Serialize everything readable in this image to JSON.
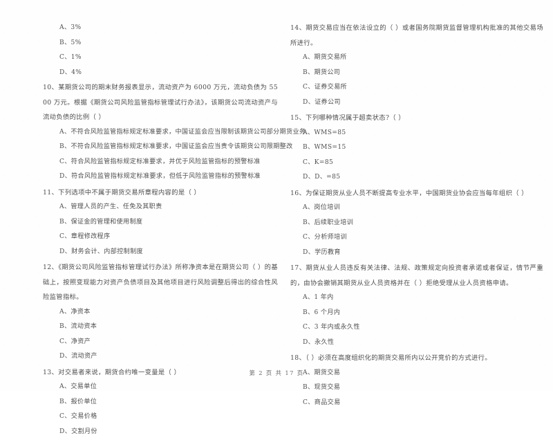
{
  "document": {
    "page_footer": "第 2 页 共 17 页",
    "page_number": "2",
    "total_pages": "17"
  },
  "left_column": {
    "continued_options": [
      "A、3%",
      "B、5%",
      "C、1%",
      "D、4%"
    ],
    "questions": [
      {
        "number": "10",
        "stem": "10、某期货公司的期末财务报表显示，流动资产为 6000 万元，流动负债为 5500 万元。根据《期货公司风险监管指标管理试行办法》，该期货公司流动资产与流动负债的比例（      ）",
        "options": [
          "A、不符合风险监管指标规定标准要求，中国证监会应当限制该期货公司部分期货业务",
          "B、不符合风险监管指标规定标准要求，中国证监会应当责令该期货公司限期整改",
          "C、符合风险监管指标规定标准要求，并优于风险监管指标的预警标准",
          "D、符合风险监管指标规定标准要求，但低于风险监管指标的预警标准"
        ]
      },
      {
        "number": "11",
        "stem": "11、下列选项中不属于期货交易所章程内容的是（      ）",
        "options": [
          "A、管理人员的产生、任免及其职责",
          "B、保证金的管理和使用制度",
          "C、章程修改程序",
          "D、财务会计、内部控制制度"
        ]
      },
      {
        "number": "12",
        "stem": "12、《期货公司风险监管指标管理试行办法》所称净资本是在期货公司（      ）的基础上，按照变现能力对资产负债项目及其他项目进行风险调整后得出的综合性风险监管指标。",
        "options": [
          "A、净资本",
          "B、流动资本",
          "C、净资产",
          "D、流动资产"
        ]
      },
      {
        "number": "13",
        "stem": "13、对交易者来说，期货合约唯一变量是（      ）",
        "options": [
          "A、交易单位",
          "B、报价单位",
          "C、交易价格",
          "D、交割月份"
        ]
      }
    ]
  },
  "right_column": {
    "questions": [
      {
        "number": "14",
        "stem": "14、期货交易应当在依法设立的（      ）或者国务院期货监督管理机构批准的其他交易场所进行。",
        "options": [
          "A、期货交易所",
          "B、期货公司",
          "C、证券交易所",
          "D、证券公司"
        ]
      },
      {
        "number": "15",
        "stem": "15、下列哪种情况属于超卖状态?（      ）",
        "options": [
          "A、WMS=85",
          "B、WMS=15",
          "C、K=85",
          "D、D、=85"
        ]
      },
      {
        "number": "16",
        "stem": "16、为保证期货从业人员不断提高专业水平，中国期货业协会应当每年组织（      ）",
        "options": [
          "A、岗位培训",
          "B、后续职业培训",
          "C、分析师培训",
          "D、学历教育"
        ]
      },
      {
        "number": "17",
        "stem": "17、期货从业人员违反有关法律、法规、政策规定向投资者承诺或者保证，情节严重的，由协会撤销其期货从业人员资格并在（      ）拒绝受理从业人员资格申请。",
        "options": [
          "A、1 年内",
          "B、6 个月内",
          "C、3 年内或永久性",
          "D、永久性"
        ]
      },
      {
        "number": "18",
        "stem": "18、（      ）必须在高度组织化的期货交易所内以公开竞价的方式进行。",
        "options": [
          "A、期货交易",
          "B、现货交易",
          "C、商品交易"
        ]
      }
    ]
  }
}
